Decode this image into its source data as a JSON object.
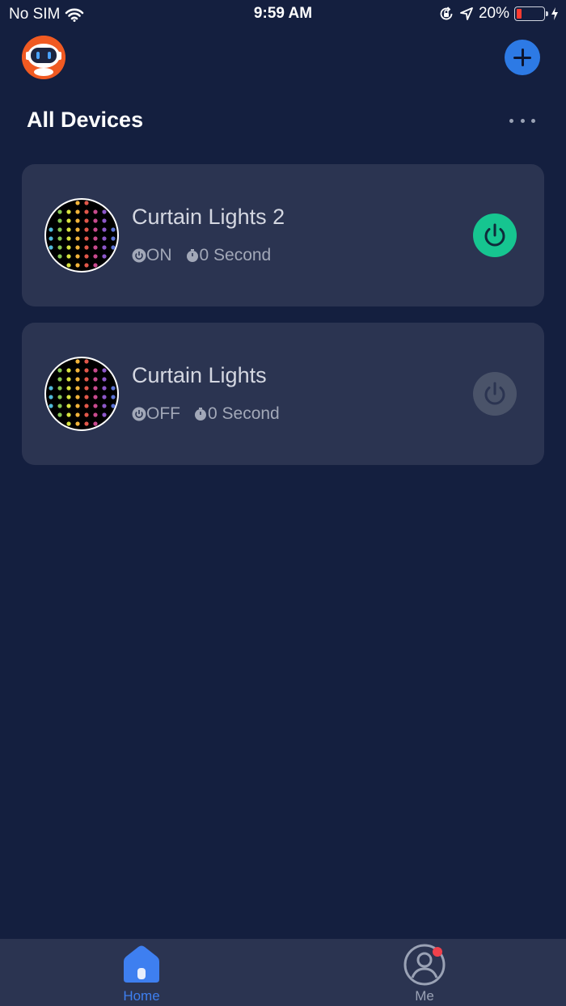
{
  "status_bar": {
    "carrier": "No SIM",
    "time": "9:59 AM",
    "battery_percent": "20%",
    "battery_level": 0.2,
    "icons": [
      "wifi-icon",
      "orientation-lock-icon",
      "location-arrow-icon",
      "battery-icon",
      "charging-bolt-icon"
    ]
  },
  "header": {
    "title": "All Devices",
    "avatar_icon": "robot-avatar-icon",
    "add_icon": "plus-icon",
    "more_icon": "more-dots-icon"
  },
  "devices": [
    {
      "name": "Curtain Lights 2",
      "state": "ON",
      "timer": "0 Second",
      "power_on": true,
      "thumb_icon": "curtain-lights-thumbnail"
    },
    {
      "name": "Curtain Lights",
      "state": "OFF",
      "timer": "0 Second",
      "power_on": false,
      "thumb_icon": "curtain-lights-thumbnail"
    }
  ],
  "tab_bar": {
    "tabs": [
      {
        "label": "Home",
        "active": true,
        "icon": "home-icon"
      },
      {
        "label": "Me",
        "active": false,
        "icon": "user-profile-icon",
        "has_notification": true
      }
    ]
  },
  "colors": {
    "background": "#141f3f",
    "card": "#2b3451",
    "accent_blue": "#2d7ae5",
    "power_on_green": "#16c590",
    "power_off_gray": "#4a5369",
    "notification_red": "#f0414c",
    "avatar_orange": "#f05a22"
  }
}
